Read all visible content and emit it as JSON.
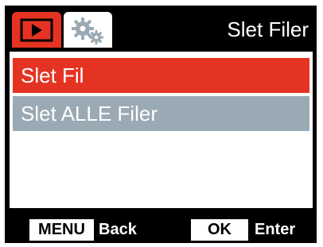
{
  "header": {
    "title": "Slet Filer",
    "tabs": [
      {
        "icon": "playback-icon",
        "active": true
      },
      {
        "icon": "settings-gears-icon",
        "active": false
      }
    ]
  },
  "menu": {
    "items": [
      {
        "label": "Slet Fil",
        "selected": true
      },
      {
        "label": "Slet ALLE Filer",
        "selected": false
      }
    ]
  },
  "footer": {
    "menu_key": "MENU",
    "menu_action": "Back",
    "ok_key": "OK",
    "ok_action": "Enter"
  },
  "colors": {
    "background": "#000000",
    "accent": "#e43322",
    "unselected_item": "#9aaab4",
    "text": "#ffffff"
  }
}
